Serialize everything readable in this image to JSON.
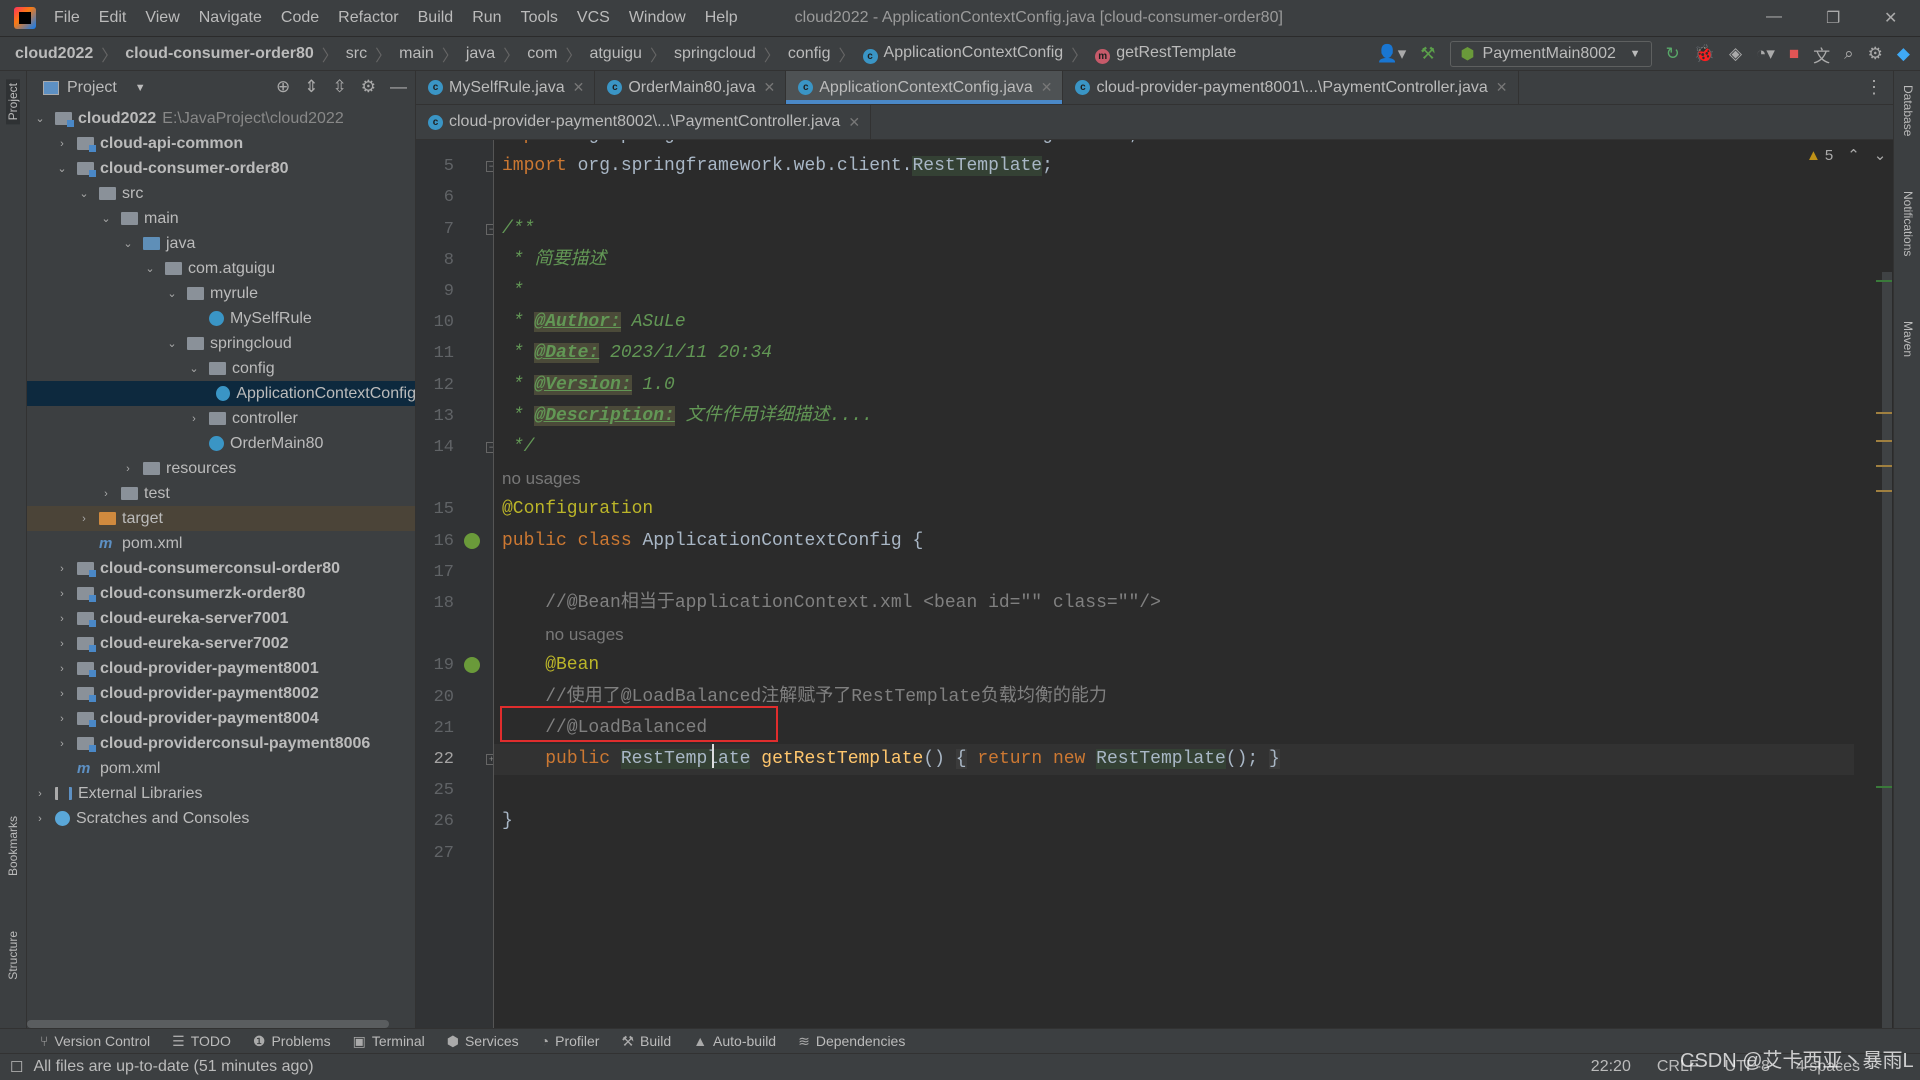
{
  "window": {
    "title": "cloud2022 - ApplicationContextConfig.java [cloud-consumer-order80]",
    "menu": [
      "File",
      "Edit",
      "View",
      "Navigate",
      "Code",
      "Refactor",
      "Build",
      "Run",
      "Tools",
      "VCS",
      "Window",
      "Help"
    ]
  },
  "breadcrumb": [
    {
      "label": "cloud2022",
      "bold": true
    },
    {
      "label": "cloud-consumer-order80",
      "bold": true
    },
    {
      "label": "src"
    },
    {
      "label": "main"
    },
    {
      "label": "java"
    },
    {
      "label": "com"
    },
    {
      "label": "atguigu"
    },
    {
      "label": "springcloud"
    },
    {
      "label": "config"
    },
    {
      "label": "ApplicationContextConfig",
      "icon": "class-icon"
    },
    {
      "label": "getRestTemplate",
      "icon": "method-icon"
    }
  ],
  "toolbar": {
    "run_config": "PaymentMain8002"
  },
  "project": {
    "title": "Project",
    "tree": [
      {
        "label": "cloud2022",
        "suffix": "E:\\JavaProject\\cloud2022",
        "level": 0,
        "arrow": "down",
        "icon": "mod",
        "bold": true
      },
      {
        "label": "cloud-api-common",
        "level": 1,
        "arrow": "right",
        "icon": "mod",
        "bold": true
      },
      {
        "label": "cloud-consumer-order80",
        "level": 1,
        "arrow": "down",
        "icon": "mod",
        "bold": true
      },
      {
        "label": "src",
        "level": 2,
        "arrow": "down",
        "icon": "folder"
      },
      {
        "label": "main",
        "level": 3,
        "arrow": "down",
        "icon": "folder"
      },
      {
        "label": "java",
        "level": 4,
        "arrow": "down",
        "icon": "src"
      },
      {
        "label": "com.atguigu",
        "level": 5,
        "arrow": "down",
        "icon": "folder"
      },
      {
        "label": "myrule",
        "level": 6,
        "arrow": "down",
        "icon": "folder"
      },
      {
        "label": "MySelfRule",
        "level": 7,
        "icon": "cls"
      },
      {
        "label": "springcloud",
        "level": 6,
        "arrow": "down",
        "icon": "folder"
      },
      {
        "label": "config",
        "level": 7,
        "arrow": "down",
        "icon": "folder"
      },
      {
        "label": "ApplicationContextConfig",
        "level": 8,
        "icon": "cls",
        "selected": true
      },
      {
        "label": "controller",
        "level": 7,
        "arrow": "right",
        "icon": "folder"
      },
      {
        "label": "OrderMain80",
        "level": 7,
        "icon": "cls"
      },
      {
        "label": "resources",
        "level": 4,
        "arrow": "right",
        "icon": "res"
      },
      {
        "label": "test",
        "level": 3,
        "arrow": "right",
        "icon": "folder"
      },
      {
        "label": "target",
        "level": 2,
        "arrow": "right",
        "icon": "tgt",
        "excluded": true
      },
      {
        "label": "pom.xml",
        "level": 2,
        "icon": "mvn"
      },
      {
        "label": "cloud-consumerconsul-order80",
        "level": 1,
        "arrow": "right",
        "icon": "mod",
        "bold": true
      },
      {
        "label": "cloud-consumerzk-order80",
        "level": 1,
        "arrow": "right",
        "icon": "mod",
        "bold": true
      },
      {
        "label": "cloud-eureka-server7001",
        "level": 1,
        "arrow": "right",
        "icon": "mod",
        "bold": true
      },
      {
        "label": "cloud-eureka-server7002",
        "level": 1,
        "arrow": "right",
        "icon": "mod",
        "bold": true
      },
      {
        "label": "cloud-provider-payment8001",
        "level": 1,
        "arrow": "right",
        "icon": "mod",
        "bold": true
      },
      {
        "label": "cloud-provider-payment8002",
        "level": 1,
        "arrow": "right",
        "icon": "mod",
        "bold": true
      },
      {
        "label": "cloud-provider-payment8004",
        "level": 1,
        "arrow": "right",
        "icon": "mod",
        "bold": true
      },
      {
        "label": "cloud-providerconsul-payment8006",
        "level": 1,
        "arrow": "right",
        "icon": "mod",
        "bold": true
      },
      {
        "label": "pom.xml",
        "level": 1,
        "icon": "mvn"
      },
      {
        "label": "External Libraries",
        "level": 0,
        "arrow": "right",
        "icon": "lib"
      },
      {
        "label": "Scratches and Consoles",
        "level": 0,
        "arrow": "right",
        "icon": "scr"
      }
    ]
  },
  "tabs_row1": [
    {
      "label": "MySelfRule.java"
    },
    {
      "label": "OrderMain80.java"
    },
    {
      "label": "ApplicationContextConfig.java",
      "active": true
    },
    {
      "label": "cloud-provider-payment8001\\...\\PaymentController.java"
    }
  ],
  "tabs_row2": [
    {
      "label": "cloud-provider-payment8002\\...\\PaymentController.java"
    }
  ],
  "editor": {
    "warnings": "5",
    "lines": [
      {
        "n": "4",
        "segs": [
          [
            "kw",
            "import"
          ],
          [
            "",
            "org.springframework.context.annotation.Configuration;"
          ]
        ]
      },
      {
        "n": "5",
        "fold": true,
        "segs": [
          [
            "kw",
            "import "
          ],
          [
            "",
            "org.springframework.web.client."
          ],
          [
            "hl",
            "RestTemplate"
          ],
          [
            "",
            ";"
          ]
        ]
      },
      {
        "n": "6",
        "segs": []
      },
      {
        "n": "7",
        "fold": true,
        "segs": [
          [
            "doc",
            "/**"
          ]
        ]
      },
      {
        "n": "8",
        "segs": [
          [
            "doc",
            " * 简要描述"
          ]
        ]
      },
      {
        "n": "9",
        "segs": [
          [
            "doc",
            " *"
          ]
        ]
      },
      {
        "n": "10",
        "segs": [
          [
            "doc",
            " * "
          ],
          [
            "tag",
            "@Author:"
          ],
          [
            "doc",
            " ASuLe"
          ]
        ]
      },
      {
        "n": "11",
        "segs": [
          [
            "doc",
            " * "
          ],
          [
            "tag",
            "@Date:"
          ],
          [
            "doc",
            " 2023/1/11 20:34"
          ]
        ]
      },
      {
        "n": "12",
        "segs": [
          [
            "doc",
            " * "
          ],
          [
            "tag",
            "@Version:"
          ],
          [
            "doc",
            " 1.0"
          ]
        ]
      },
      {
        "n": "13",
        "segs": [
          [
            "doc",
            " * "
          ],
          [
            "tag",
            "@Description:"
          ],
          [
            "doc",
            " 文件作用详细描述...."
          ]
        ]
      },
      {
        "n": "14",
        "fold": true,
        "segs": [
          [
            "doc",
            " */"
          ]
        ]
      },
      {
        "inlay": "no usages",
        "indent": ""
      },
      {
        "n": "15",
        "segs": [
          [
            "ann",
            "@Configuration"
          ]
        ]
      },
      {
        "n": "16",
        "bean": true,
        "segs": [
          [
            "kw",
            "public class "
          ],
          [
            "",
            "ApplicationContextConfig {"
          ]
        ]
      },
      {
        "n": "17",
        "segs": []
      },
      {
        "n": "18",
        "segs": [
          [
            "cm",
            "    //@Bean相当于applicationContext.xml <bean id=\"\" class=\"\"/>"
          ]
        ]
      },
      {
        "inlay": "no usages",
        "indent": "    "
      },
      {
        "n": "19",
        "bean": true,
        "segs": [
          [
            "ann",
            "    @Bean"
          ]
        ]
      },
      {
        "n": "20",
        "segs": [
          [
            "cm",
            "    //使用了@LoadBalanced注解赋予了RestTemplate负载均衡的能力"
          ]
        ]
      },
      {
        "n": "21",
        "segs": [
          [
            "cm",
            "    //@LoadBalanced"
          ]
        ]
      },
      {
        "n": "22",
        "fold": true,
        "current": true,
        "segs": [
          [
            "",
            "    "
          ],
          [
            "kw",
            "public "
          ],
          [
            "hl",
            "RestTemplate"
          ],
          [
            "",
            " "
          ],
          [
            "mth",
            "getRestTemplate"
          ],
          [
            "",
            "() "
          ],
          [
            "br",
            "{"
          ],
          [
            "",
            " "
          ],
          [
            "kw",
            "return new "
          ],
          [
            "hl",
            "RestTemplate"
          ],
          [
            "",
            "(); "
          ],
          [
            "br",
            "}"
          ]
        ]
      },
      {
        "n": "25",
        "segs": []
      },
      {
        "n": "26",
        "segs": [
          [
            "",
            "}"
          ]
        ]
      },
      {
        "n": "27",
        "segs": []
      }
    ]
  },
  "side_left": [
    "Project",
    "Bookmarks",
    "Structure"
  ],
  "side_right": [
    "Database",
    "Notifications",
    "Maven"
  ],
  "bottom_tools": [
    {
      "label": "Version Control",
      "icon": "⑂"
    },
    {
      "label": "TODO",
      "icon": "☰"
    },
    {
      "label": "Problems",
      "icon": "❶"
    },
    {
      "label": "Terminal",
      "icon": "▣"
    },
    {
      "label": "Services",
      "icon": "⬢"
    },
    {
      "label": "Profiler",
      "icon": "◔"
    },
    {
      "label": "Build",
      "icon": "⚒"
    },
    {
      "label": "Auto-build",
      "icon": "▲"
    },
    {
      "label": "Dependencies",
      "icon": "≋"
    }
  ],
  "status": {
    "message": "All files are up-to-date (51 minutes ago)",
    "position": "22:20",
    "line_sep": "CRLF",
    "encoding": "UTF-8",
    "indent": "4 spaces"
  },
  "watermark": "CSDN @艾卡西亚丶暴雨L"
}
